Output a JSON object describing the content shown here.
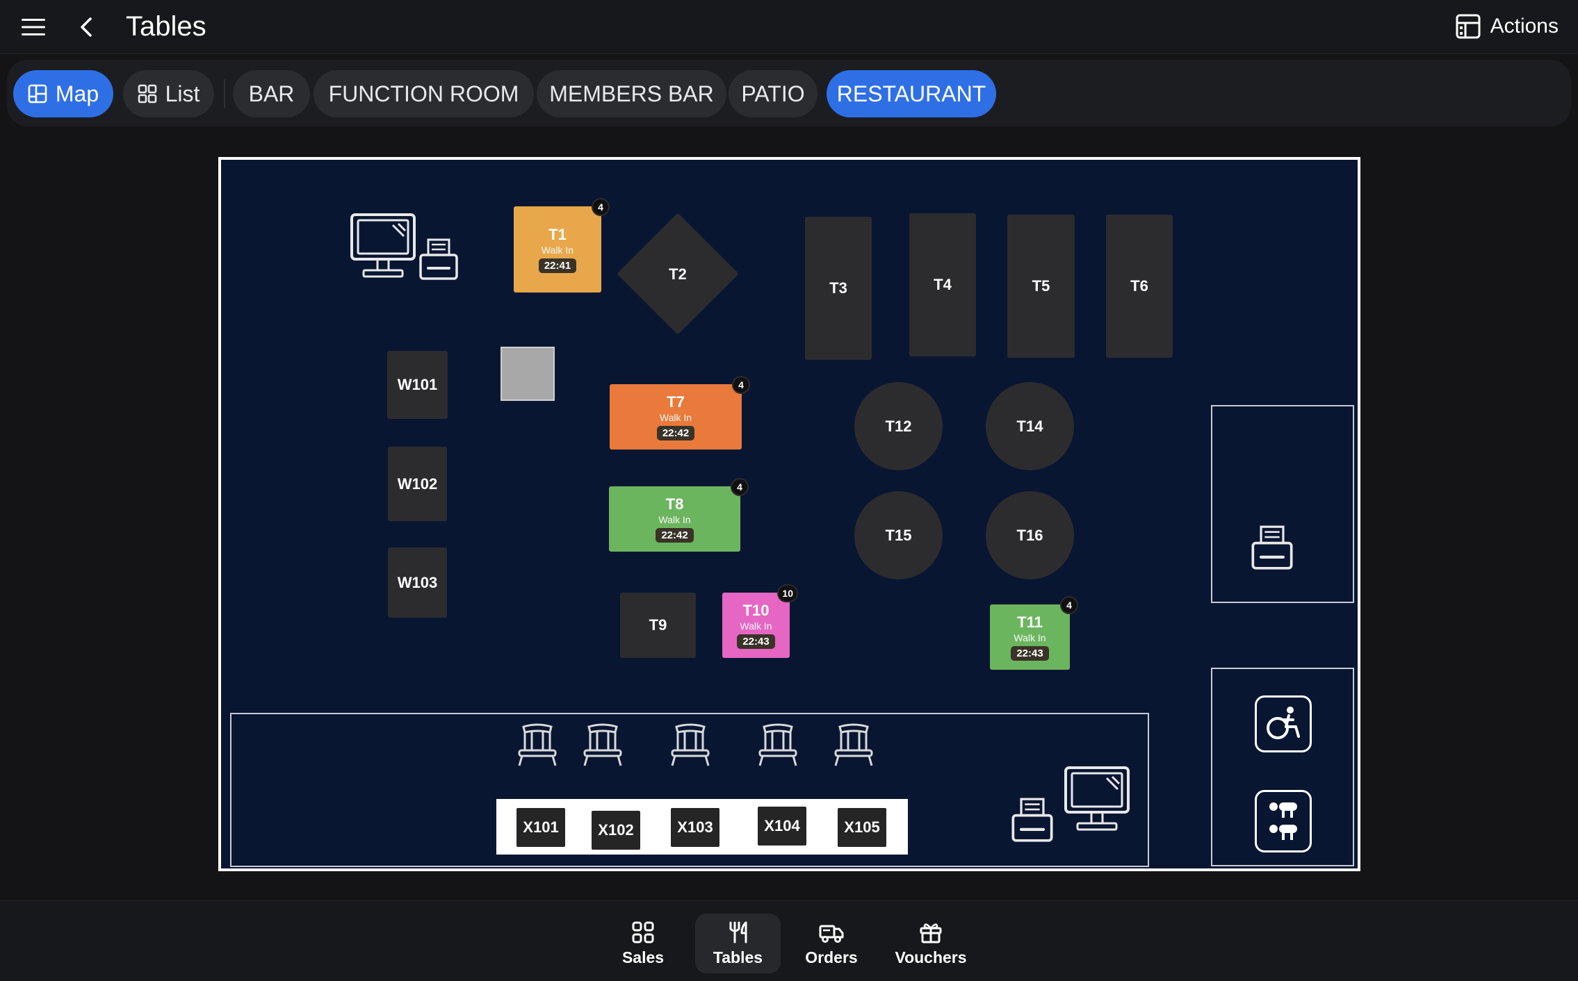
{
  "header": {
    "title": "Tables",
    "actions_label": "Actions"
  },
  "view_tabs": [
    {
      "label": "Map",
      "active": true
    },
    {
      "label": "List",
      "active": false
    }
  ],
  "area_tabs": [
    {
      "label": "BAR",
      "active": false
    },
    {
      "label": "FUNCTION ROOM",
      "active": false
    },
    {
      "label": "MEMBERS BAR",
      "active": false
    },
    {
      "label": "PATIO",
      "active": false
    },
    {
      "label": "RESTAURANT",
      "active": true
    }
  ],
  "colors": {
    "accent": "#2f6fe6",
    "floor": "#081632",
    "table_empty": "#2c2c2e",
    "occupied_amber": "#e8a74a",
    "occupied_orange": "#e97a3c",
    "occupied_green": "#6cb55f",
    "occupied_pink": "#e667c3"
  },
  "tables": {
    "T1": {
      "name": "T1",
      "status": "Walk In",
      "time": "22:41",
      "guests": "4"
    },
    "T2": {
      "name": "T2"
    },
    "T3": {
      "name": "T3"
    },
    "T4": {
      "name": "T4"
    },
    "T5": {
      "name": "T5"
    },
    "T6": {
      "name": "T6"
    },
    "T7": {
      "name": "T7",
      "status": "Walk In",
      "time": "22:42",
      "guests": "4"
    },
    "T8": {
      "name": "T8",
      "status": "Walk In",
      "time": "22:42",
      "guests": "4"
    },
    "T9": {
      "name": "T9"
    },
    "T10": {
      "name": "T10",
      "status": "Walk In",
      "time": "22:43",
      "guests": "10"
    },
    "T11": {
      "name": "T11",
      "status": "Walk In",
      "time": "22:43",
      "guests": "4"
    },
    "T12": {
      "name": "T12"
    },
    "T14": {
      "name": "T14"
    },
    "T15": {
      "name": "T15"
    },
    "T16": {
      "name": "T16"
    },
    "W101": {
      "name": "W101"
    },
    "W102": {
      "name": "W102"
    },
    "W103": {
      "name": "W103"
    },
    "X101": {
      "name": "X101"
    },
    "X102": {
      "name": "X102"
    },
    "X103": {
      "name": "X103"
    },
    "X104": {
      "name": "X104"
    },
    "X105": {
      "name": "X105"
    }
  },
  "fixture_icons": [
    "pos-terminal-icon",
    "receipt-printer-icon",
    "accessible-restroom-icon",
    "restroom-icon",
    "bar-stool-icon"
  ],
  "bottom_nav": [
    {
      "label": "Sales",
      "active": false
    },
    {
      "label": "Tables",
      "active": true
    },
    {
      "label": "Orders",
      "active": false
    },
    {
      "label": "Vouchers",
      "active": false
    }
  ]
}
